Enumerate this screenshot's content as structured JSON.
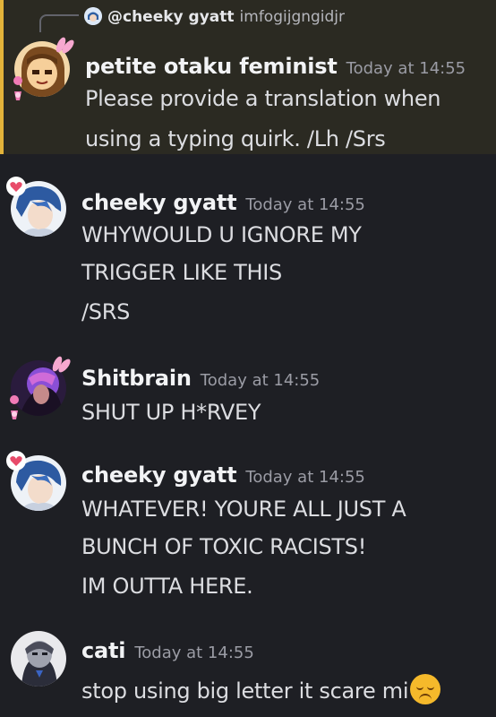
{
  "reply_preview": {
    "username": "@cheeky gyatt",
    "text": "imfogijgngidjr"
  },
  "messages": [
    {
      "author": "petite otaku feminist",
      "timestamp": "Today at 14:55",
      "lines": [
        "Please provide a translation when",
        "using a typing quirk. /Lh /Srs"
      ],
      "highlighted": true
    },
    {
      "author": "cheeky gyatt",
      "timestamp": "Today at 14:55",
      "lines": [
        "WHYWOULD U IGNORE MY",
        "TRIGGER LIKE THIS",
        "/SRS"
      ]
    },
    {
      "author": "Shitbrain",
      "timestamp": "Today at 14:55",
      "lines": [
        "SHUT UP H*RVEY"
      ]
    },
    {
      "author": "cheeky gyatt",
      "timestamp": "Today at 14:55",
      "lines": [
        "WHATEVER! YOURE ALL JUST A",
        "BUNCH OF TOXIC RACISTS!",
        "IM OUTTA HERE."
      ]
    },
    {
      "author": "cati",
      "timestamp": "Today at 14:55",
      "lines": [
        "stop using big letter it scare mi"
      ],
      "trailing_emoji": "disappointed-face"
    }
  ],
  "colors": {
    "background": "#1e1f24",
    "highlight_bg": "#2b2a22",
    "highlight_border": "#e3b33a",
    "author": "#f2f3f5",
    "timestamp": "#9b9ca5",
    "text": "#dcdde1"
  }
}
